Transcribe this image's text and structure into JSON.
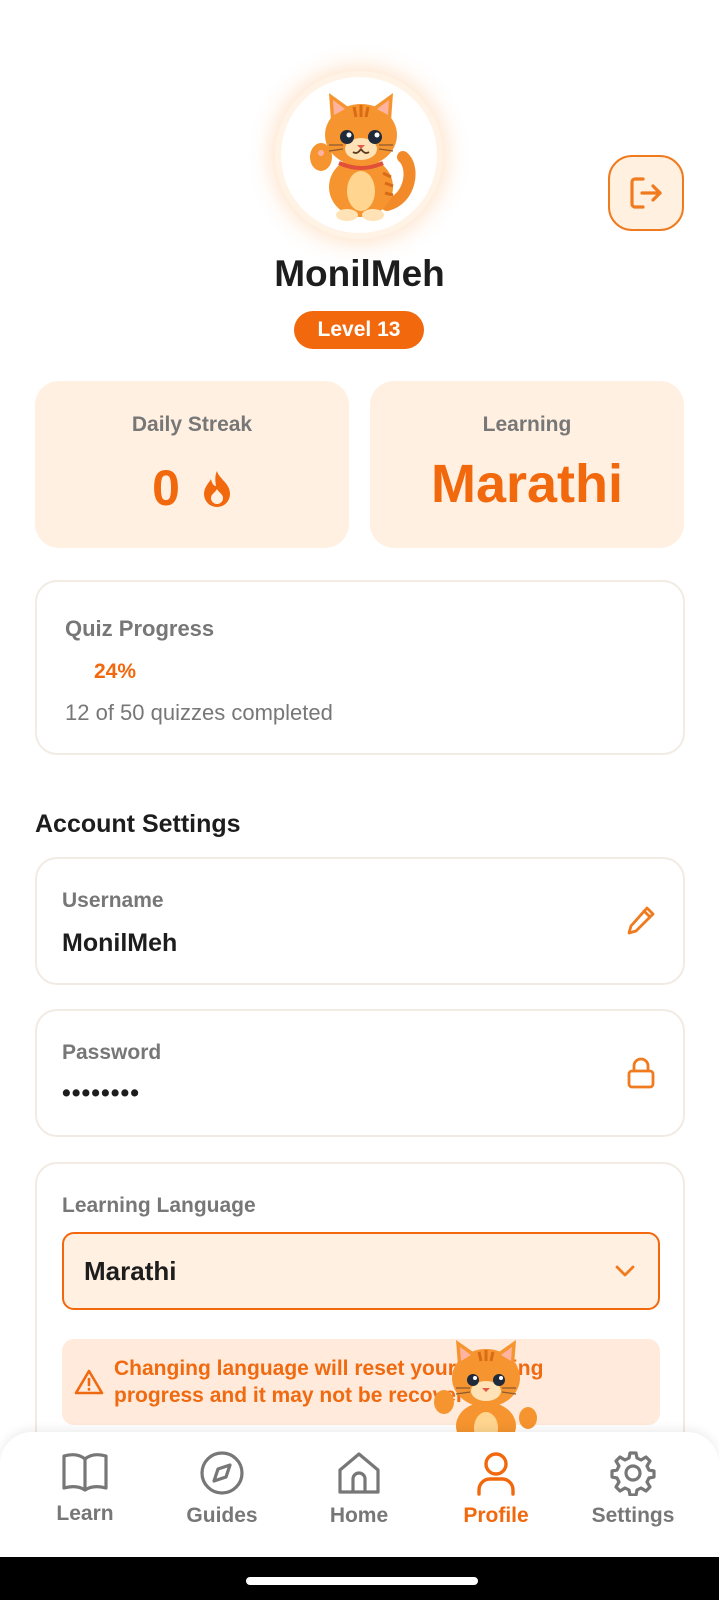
{
  "profile": {
    "username": "MonilMeh",
    "level_label": "Level 13",
    "avatar_icon": "cat-mascot-icon",
    "logout_icon": "logout-icon"
  },
  "stats": {
    "streak_label": "Daily Streak",
    "streak_value": "0",
    "streak_icon": "flame-icon",
    "learning_label": "Learning",
    "learning_value": "Marathi"
  },
  "quiz": {
    "title": "Quiz Progress",
    "percent_label": "24%",
    "progress_fraction": 0.24,
    "summary": "12 of 50 quizzes completed"
  },
  "account": {
    "section_title": "Account Settings",
    "username_label": "Username",
    "username_value": "MonilMeh",
    "username_icon": "pencil-icon",
    "password_label": "Password",
    "password_value": "••••••••",
    "password_icon": "lock-icon",
    "language_label": "Learning Language",
    "language_selected": "Marathi",
    "language_icon": "chevron-down-icon",
    "warning_icon": "warning-triangle-icon",
    "warning_text": "Changing language will reset your learning progress and it may not be recovered"
  },
  "nav": {
    "items": [
      {
        "label": "Learn",
        "icon": "book-icon"
      },
      {
        "label": "Guides",
        "icon": "compass-icon"
      },
      {
        "label": "Home",
        "icon": "home-icon"
      },
      {
        "label": "Profile",
        "icon": "user-icon"
      },
      {
        "label": "Settings",
        "icon": "gear-icon"
      }
    ],
    "active": "Profile"
  },
  "colors": {
    "accent": "#f2680d",
    "card_bg": "#fff0e2",
    "muted_text": "#777777",
    "text": "#1d1d1d"
  }
}
